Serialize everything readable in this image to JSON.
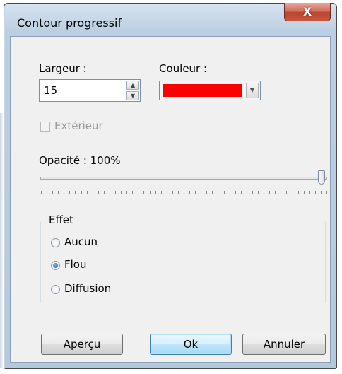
{
  "window": {
    "title": "Contour progressif",
    "close_glyph": "X"
  },
  "width_field": {
    "label": "Largeur :",
    "value": "15"
  },
  "color_field": {
    "label": "Couleur :",
    "value": "#ff0000"
  },
  "outer_checkbox": {
    "label": "Extérieur",
    "checked": false,
    "enabled": false
  },
  "opacity": {
    "label": "Opacité : 100%",
    "value": 100
  },
  "effect": {
    "title": "Effet",
    "options": [
      {
        "label": "Aucun",
        "selected": false
      },
      {
        "label": "Flou",
        "selected": true
      },
      {
        "label": "Diffusion",
        "selected": false
      }
    ]
  },
  "buttons": {
    "preview": "Aperçu",
    "ok": "Ok",
    "cancel": "Annuler"
  },
  "icons": {
    "spin_up": "triangle-up-icon",
    "spin_down": "triangle-down-icon",
    "dropdown": "chevron-down-icon",
    "close": "close-icon"
  }
}
